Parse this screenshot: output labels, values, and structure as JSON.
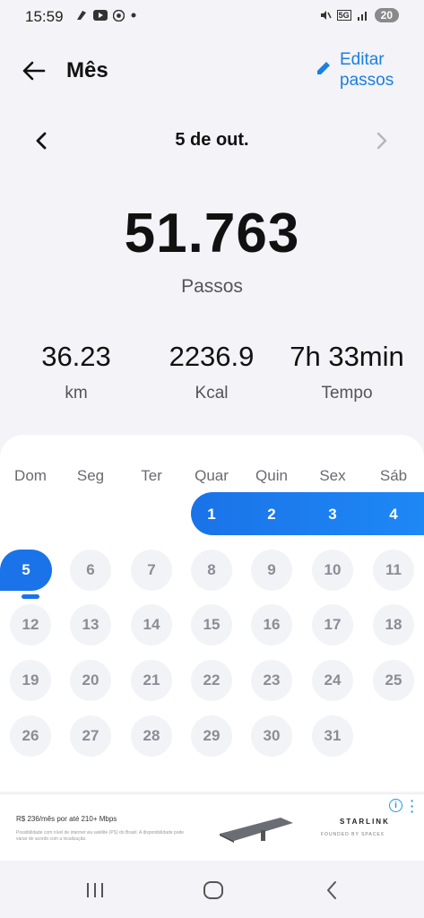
{
  "status_bar": {
    "time": "15:59",
    "left_icons": [
      "signal-app-icon",
      "youtube-icon",
      "chrome-icon",
      "dot-icon"
    ],
    "right_icons": [
      "mute-icon",
      "5g-icon",
      "signal-icon"
    ],
    "network": "5G",
    "battery": "20"
  },
  "header": {
    "title": "Mês",
    "edit_label_line1": "Editar",
    "edit_label_line2": "passos"
  },
  "date_nav": {
    "label": "5 de out."
  },
  "summary": {
    "steps": "51.763",
    "steps_label": "Passos"
  },
  "stats": [
    {
      "value": "36.23",
      "label": "km"
    },
    {
      "value": "2236.9",
      "label": "Kcal"
    },
    {
      "value": "7h 33min",
      "label": "Tempo"
    }
  ],
  "calendar": {
    "weekdays": [
      "Dom",
      "Seg",
      "Ter",
      "Quar",
      "Quin",
      "Sex",
      "Sáb"
    ],
    "weeks": [
      [
        "",
        "",
        "",
        "1",
        "2",
        "3",
        "4"
      ],
      [
        "5",
        "6",
        "7",
        "8",
        "9",
        "10",
        "11"
      ],
      [
        "12",
        "13",
        "14",
        "15",
        "16",
        "17",
        "18"
      ],
      [
        "19",
        "20",
        "21",
        "22",
        "23",
        "24",
        "25"
      ],
      [
        "26",
        "27",
        "28",
        "29",
        "30",
        "31",
        ""
      ]
    ],
    "selected_day": "5",
    "accent_color": "#1a73e8"
  },
  "ad": {
    "line1": "R$ 236/mês por até 210+ Mbps",
    "line2": "Possibilidade com nível de internet via satélite (PS) do Brasil. A disponibilidade pode variar de acordo com a localização.",
    "brand": "STARLINK",
    "brand_sub": "FOUNDED BY SPACEX"
  },
  "colors": {
    "accent": "#1a73e8",
    "link": "#1c7fe0",
    "background": "#f3f3f8"
  }
}
